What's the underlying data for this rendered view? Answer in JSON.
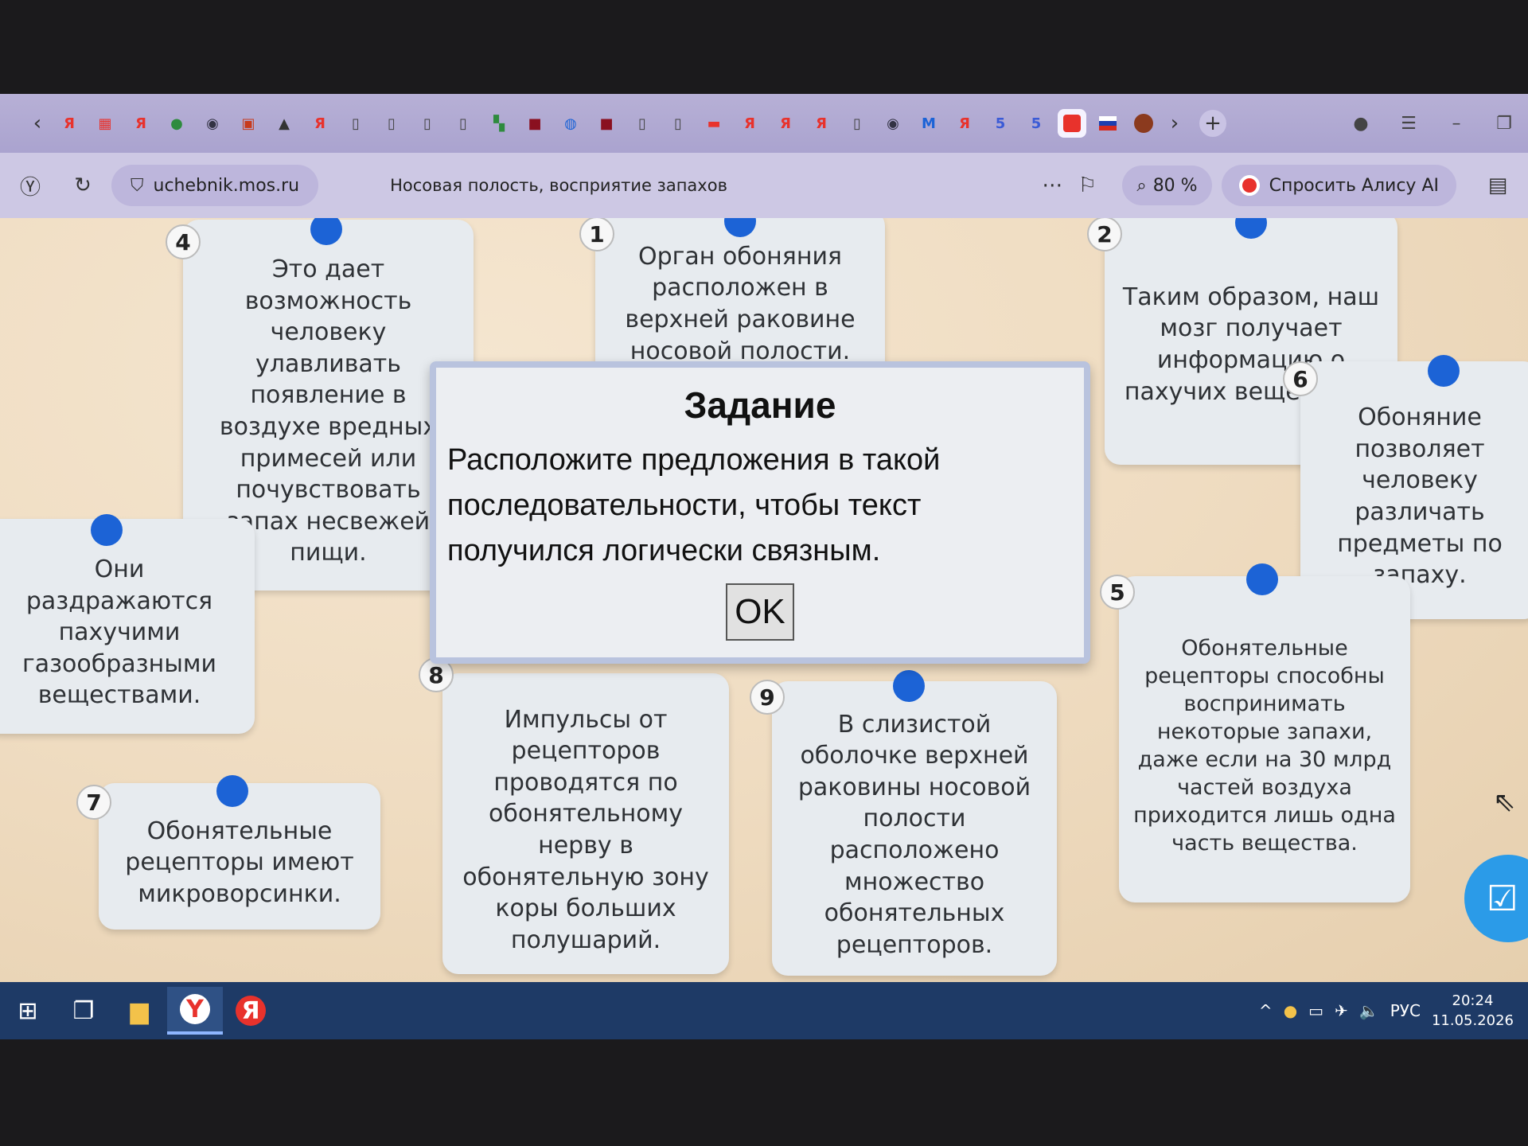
{
  "browser": {
    "url": "uchebnik.mos.ru",
    "page_title": "Носовая полость, восприятие запахов",
    "zoom": "80 %",
    "alice_label": "Спросить Алису AI",
    "tab_icons": [
      {
        "name": "yandex-icon",
        "glyph": "Я",
        "color": "#e8322c"
      },
      {
        "name": "grid-icon",
        "glyph": "▦",
        "color": "#e8322c"
      },
      {
        "name": "yandex-icon",
        "glyph": "Я",
        "color": "#e8322c"
      },
      {
        "name": "globe-icon",
        "glyph": "●",
        "color": "#2e8b3e"
      },
      {
        "name": "browser-icon",
        "glyph": "◉",
        "color": "#334"
      },
      {
        "name": "app-icon",
        "glyph": "▣",
        "color": "#c73b1d"
      },
      {
        "name": "triangle-icon",
        "glyph": "▲",
        "color": "#333"
      },
      {
        "name": "yandex-icon",
        "glyph": "Я",
        "color": "#e8322c"
      },
      {
        "name": "page-icon",
        "glyph": "▯",
        "color": "#444"
      },
      {
        "name": "page-icon",
        "glyph": "▯",
        "color": "#444"
      },
      {
        "name": "page-icon",
        "glyph": "▯",
        "color": "#444"
      },
      {
        "name": "page-icon",
        "glyph": "▯",
        "color": "#444"
      },
      {
        "name": "puzzle-icon",
        "glyph": "▚",
        "color": "#2e8b3e"
      },
      {
        "name": "gto-icon",
        "glyph": "■",
        "color": "#8a1020"
      },
      {
        "name": "sphere-icon",
        "glyph": "◍",
        "color": "#1c63d6"
      },
      {
        "name": "gto-icon",
        "glyph": "■",
        "color": "#8a1020"
      },
      {
        "name": "page-icon",
        "glyph": "▯",
        "color": "#444"
      },
      {
        "name": "page-icon",
        "glyph": "▯",
        "color": "#444"
      },
      {
        "name": "mail-icon",
        "glyph": "▬",
        "color": "#e8322c"
      },
      {
        "name": "yandex-icon",
        "glyph": "Я",
        "color": "#e8322c"
      },
      {
        "name": "yandex-icon",
        "glyph": "Я",
        "color": "#e8322c"
      },
      {
        "name": "yandex-icon",
        "glyph": "Я",
        "color": "#e8322c"
      },
      {
        "name": "page-icon",
        "glyph": "▯",
        "color": "#444"
      },
      {
        "name": "browser-icon",
        "glyph": "◉",
        "color": "#334"
      },
      {
        "name": "m-icon",
        "glyph": "M",
        "color": "#1c63d6"
      },
      {
        "name": "yandex-icon",
        "glyph": "Я",
        "color": "#e8322c"
      },
      {
        "name": "five-icon",
        "glyph": "5",
        "color": "#3b5bd6"
      },
      {
        "name": "five-icon",
        "glyph": "5",
        "color": "#3b5bd6"
      }
    ]
  },
  "task": {
    "title": "Задание",
    "instruction": "Расположите предложения в такой последовательности, чтобы текст получился логически связным.",
    "ok_label": "OK"
  },
  "cards": [
    {
      "number": "4",
      "text": "Это дает возможность человеку улавливать появление в воздухе вредных примесей или почувствовать запах несвежей пищи."
    },
    {
      "number": "1",
      "text": "Орган обоняния расположен в верхней раковине носовой полости."
    },
    {
      "number": "2",
      "text": "Таким образом, наш мозг получает информацию о пахучих веществах."
    },
    {
      "number": "6",
      "text": "Обоняние позволяет человеку различать предметы по запаху."
    },
    {
      "number": "",
      "text": "Они раздражаются пахучими газообразными веществами."
    },
    {
      "number": "8",
      "text": "Импульсы от рецепторов проводятся по обонятельному нерву в обонятельную зону коры больших полушарий."
    },
    {
      "number": "9",
      "text": "В слизистой оболочке верхней раковины носовой полости расположено множество обонятельных рецепторов."
    },
    {
      "number": "5",
      "text": "Обонятельные рецепторы способны воспринимать некоторые запахи, даже если на 30 млрд частей воздуха приходится лишь одна часть вещества."
    },
    {
      "number": "7",
      "text": "Обонятельные рецепторы имеют микроворсинки."
    }
  ],
  "taskbar": {
    "lang": "РУС",
    "time": "20:24",
    "date": "11.05.2026"
  }
}
